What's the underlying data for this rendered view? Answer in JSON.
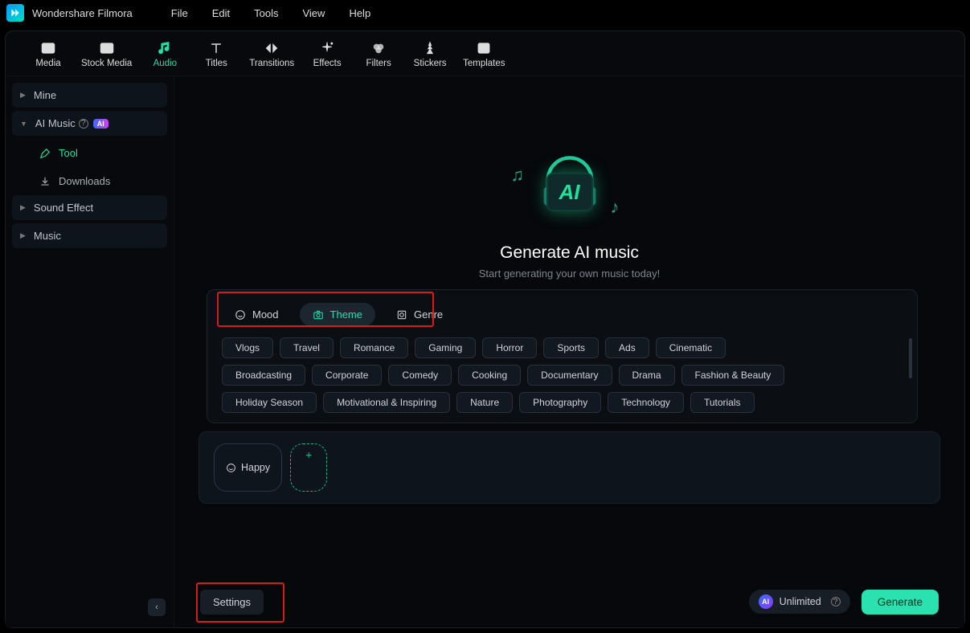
{
  "app_title": "Wondershare Filmora",
  "menubar": {
    "file": "File",
    "edit": "Edit",
    "tools": "Tools",
    "view": "View",
    "help": "Help"
  },
  "toolbar": {
    "media": "Media",
    "stock_media": "Stock Media",
    "audio": "Audio",
    "titles": "Titles",
    "transitions": "Transitions",
    "effects": "Effects",
    "filters": "Filters",
    "stickers": "Stickers",
    "templates": "Templates"
  },
  "sidebar": {
    "mine": "Mine",
    "ai_music": "AI Music",
    "ai_badge": "AI",
    "tool": "Tool",
    "downloads": "Downloads",
    "sound_effect": "Sound Effect",
    "music": "Music"
  },
  "hero": {
    "title": "Generate AI music",
    "subtitle": "Start generating your own music today!",
    "logo_text": "AI"
  },
  "tabs": {
    "mood": "Mood",
    "theme": "Theme",
    "genre": "Genre"
  },
  "chips": {
    "r0": {
      "c0": "Vlogs",
      "c1": "Travel",
      "c2": "Romance",
      "c3": "Gaming",
      "c4": "Horror",
      "c5": "Sports",
      "c6": "Ads",
      "c7": "Cinematic"
    },
    "r1": {
      "c0": "Broadcasting",
      "c1": "Corporate",
      "c2": "Comedy",
      "c3": "Cooking",
      "c4": "Documentary",
      "c5": "Drama",
      "c6": "Fashion & Beauty"
    },
    "r2": {
      "c0": "Holiday Season",
      "c1": "Motivational & Inspiring",
      "c2": "Nature",
      "c3": "Photography",
      "c4": "Technology",
      "c5": "Tutorials"
    }
  },
  "selection": {
    "happy": "Happy",
    "add": "+"
  },
  "footer": {
    "settings": "Settings",
    "unlimited": "Unlimited",
    "generate": "Generate",
    "help_q": "?"
  }
}
